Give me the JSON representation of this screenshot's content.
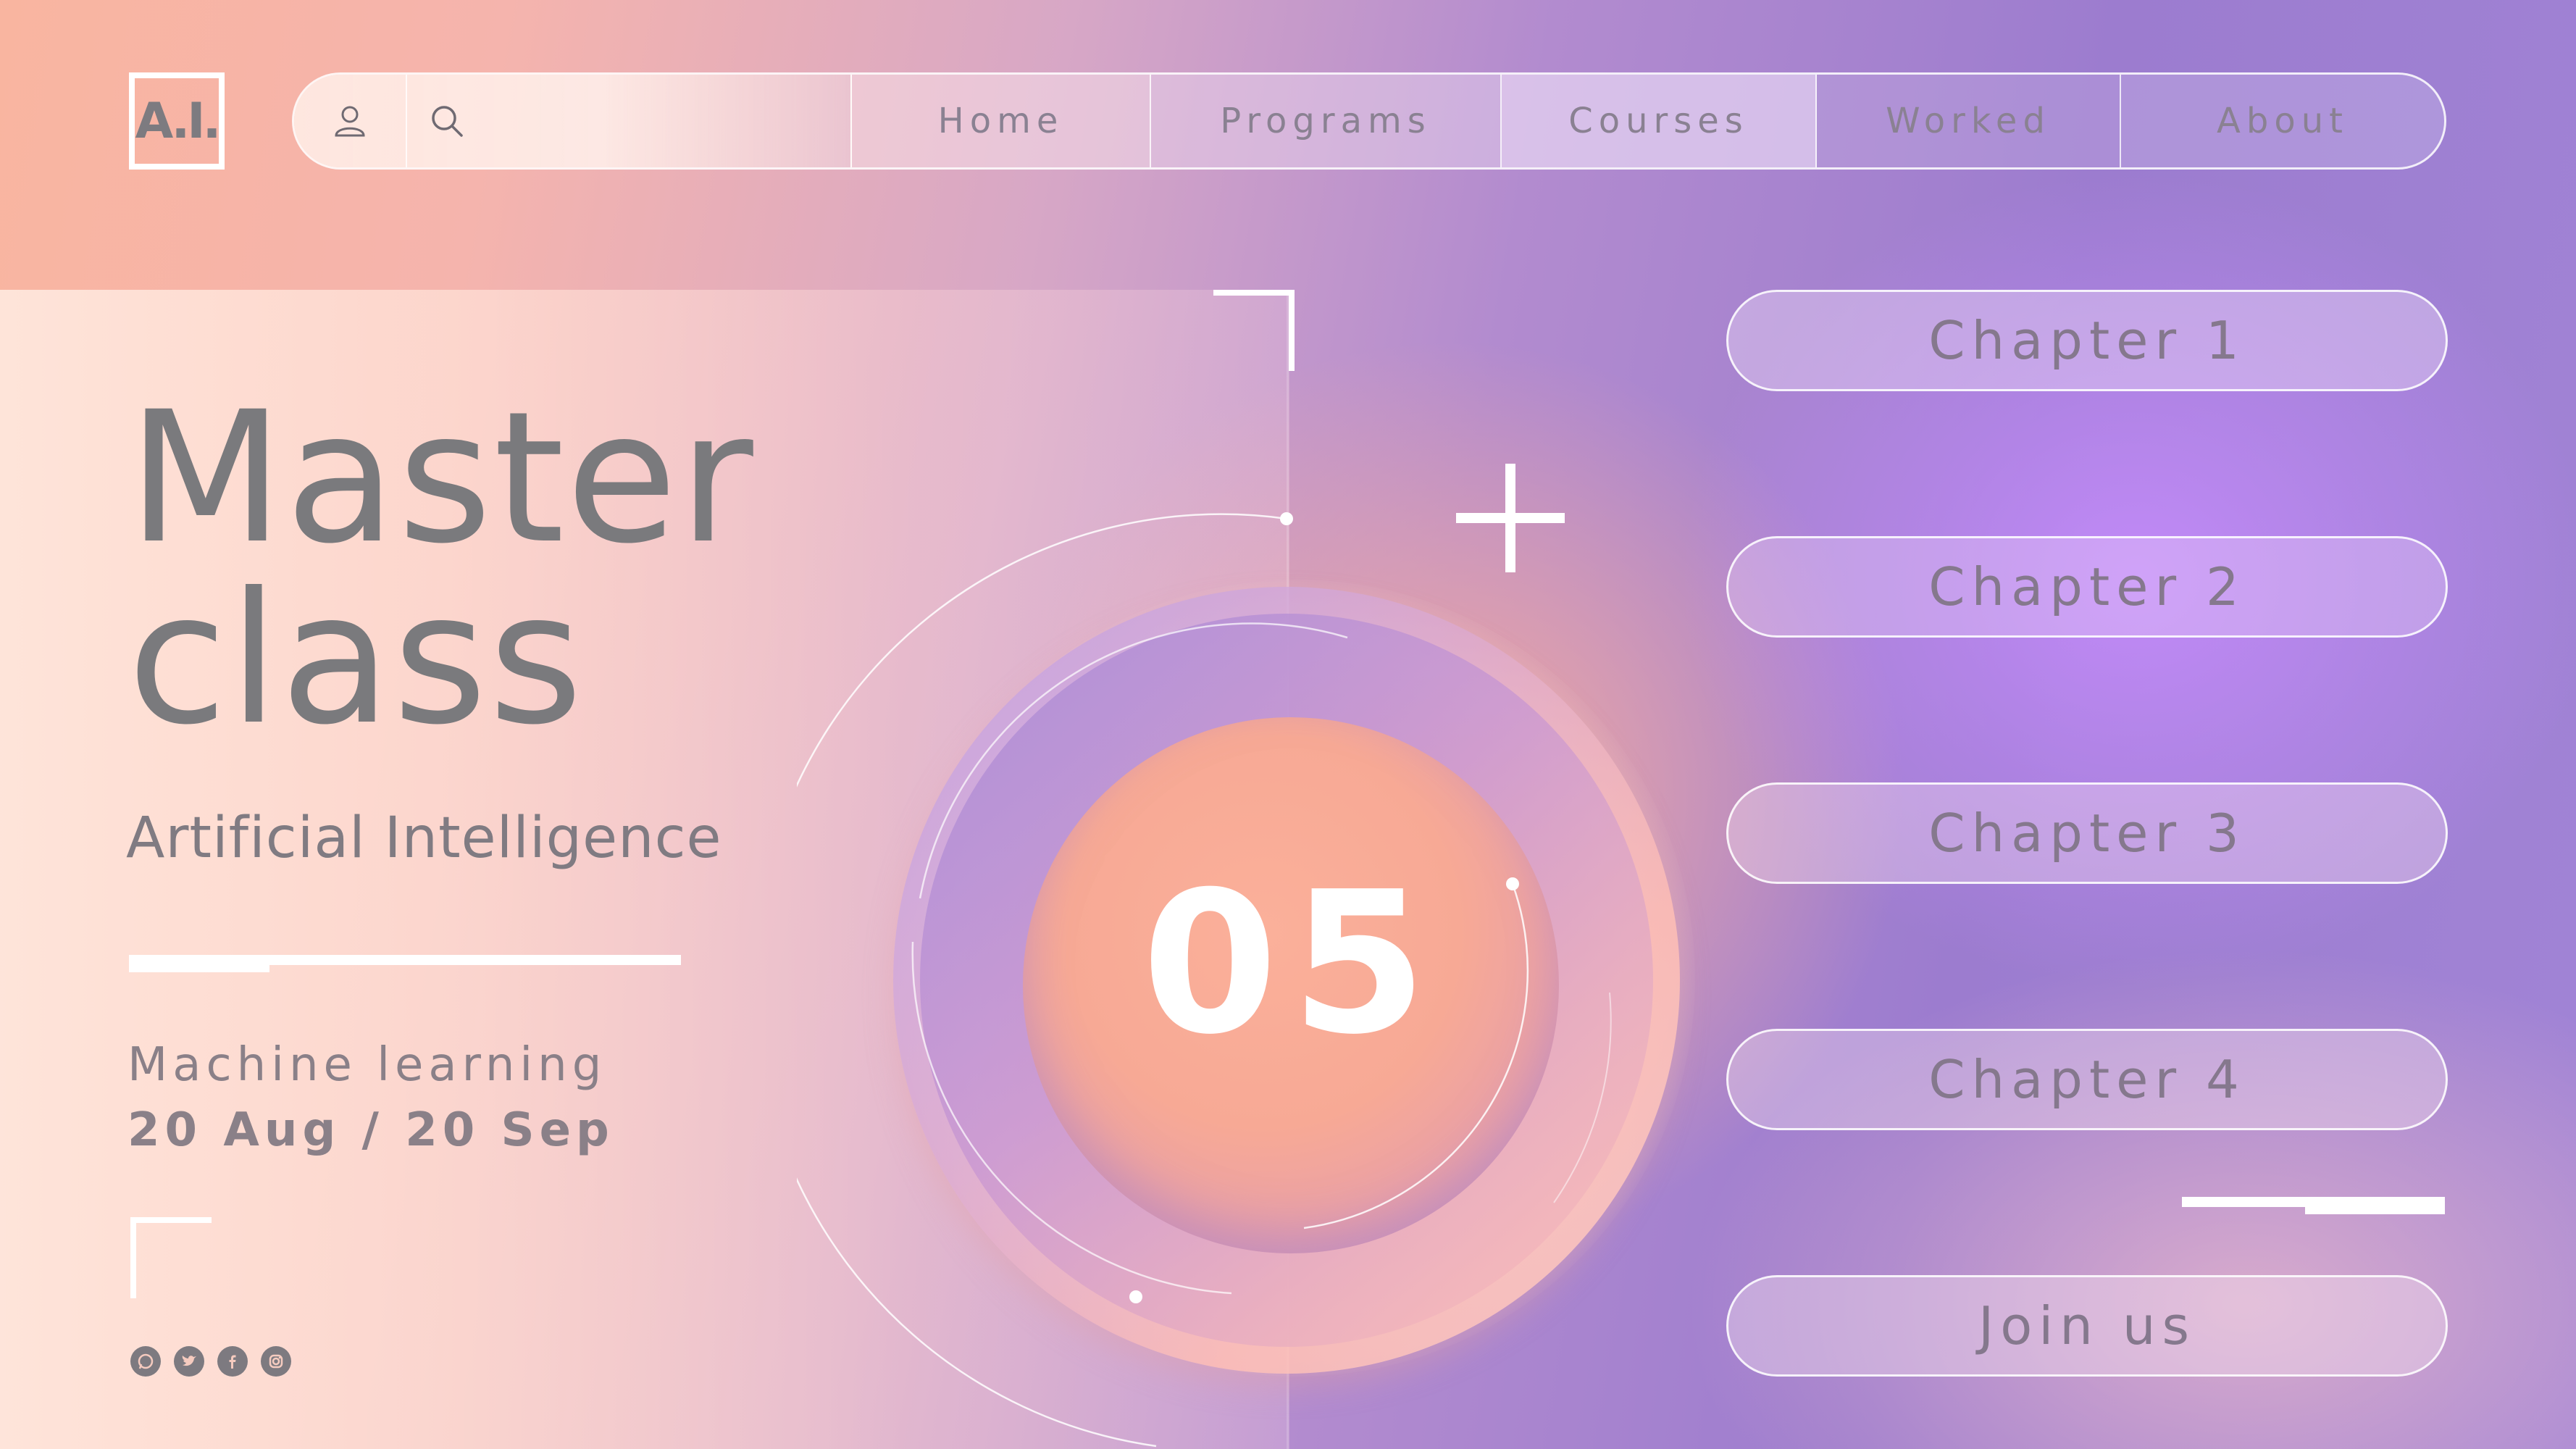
{
  "logo": {
    "text": "A.I."
  },
  "nav": {
    "items": [
      {
        "label": "Home"
      },
      {
        "label": "Programs"
      },
      {
        "label": "Courses"
      },
      {
        "label": "Worked"
      },
      {
        "label": "About"
      }
    ],
    "icons": [
      "user-icon",
      "search-icon"
    ]
  },
  "hero": {
    "title_line1": "Master",
    "title_line2": "class",
    "subtitle": "Artificial Intelligence",
    "topic": "Machine learning",
    "dates": "20 Aug / 20 Sep"
  },
  "counter": {
    "value": "05"
  },
  "chapters": [
    {
      "label": "Chapter 1"
    },
    {
      "label": "Chapter 2"
    },
    {
      "label": "Chapter 3"
    },
    {
      "label": "Chapter 4"
    }
  ],
  "cta": {
    "label": "Join us"
  },
  "socials": [
    "whatsapp-icon",
    "twitter-icon",
    "facebook-icon",
    "instagram-icon"
  ],
  "colors": {
    "text_gray": "#7a7a7d",
    "accent_white": "#ffffff",
    "peach": "#f9b5a0",
    "lavender": "#9c7ccf"
  }
}
